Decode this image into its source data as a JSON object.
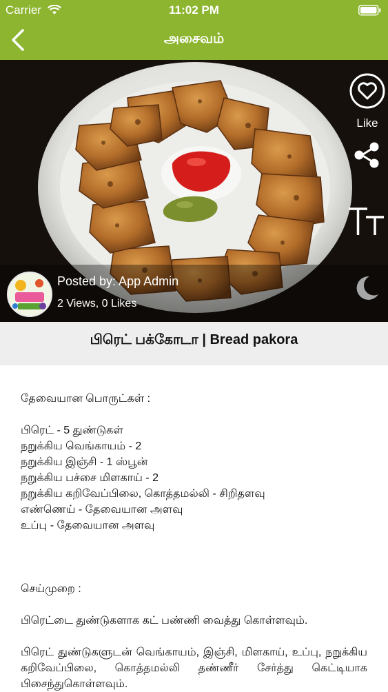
{
  "status_bar": {
    "carrier": "Carrier",
    "time": "11:02 PM",
    "icons": [
      "wifi-icon",
      "battery-icon"
    ]
  },
  "nav": {
    "title": "அசைவம்",
    "back_icon": "chevron-left-icon"
  },
  "hero": {
    "actions": {
      "like_label": "Like",
      "icons": [
        "heart-icon",
        "share-icon",
        "text-size-icon",
        "moon-icon"
      ]
    },
    "author": {
      "posted_by": "Posted by: App Admin",
      "stats": "2 Views, 0 Likes"
    }
  },
  "recipe": {
    "title": "பிரெட் பக்கோடா | Bread pakora",
    "ingredients_heading": "தேவையான பொருட்கள் :",
    "ingredients": [
      "பிரெட் - 5 துண்டுகள்",
      "நறுக்கிய வெங்காயம் - 2",
      "நறுக்கிய இஞ்சி  - 1 ஸ்பூன்",
      "நறுக்கிய பச்சை மிளகாய் - 2",
      "நறுக்கிய கறிவேப்பிலை, கொத்தமல்லி - சிறிதளவு",
      "எண்ணெய் - தேவையான அளவு",
      "உப்பு - தேவையான அளவு"
    ],
    "method_heading": "செய்முறை :",
    "steps": [
      "பிரெட்டை துண்டுகளாக கட் பண்ணி வைத்து கொள்ளவும்.",
      "பிரெட் துண்டுகளுடன் வெங்காயம், இஞ்சி, மிளகாய், உப்பு, நறுக்கிய கறிவேப்பிலை, கொத்தமல்லி தண்ணீர் சேர்த்து கெட்டியாக பிசைந்துகொள்ளவும்."
    ]
  },
  "colors": {
    "accent": "#8db52f",
    "title_band": "#eeeeee"
  }
}
